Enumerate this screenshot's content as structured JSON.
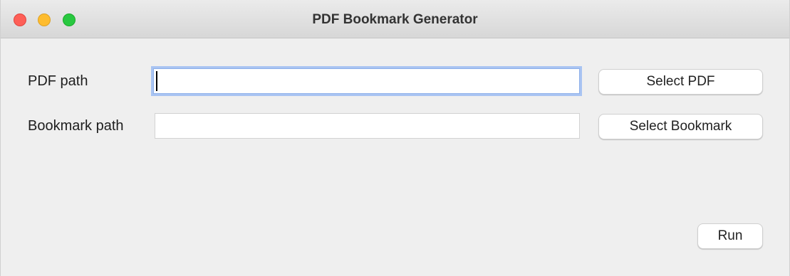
{
  "window": {
    "title": "PDF Bookmark Generator",
    "controls": [
      {
        "name": "close",
        "color": "#fe5f57"
      },
      {
        "name": "minimize",
        "color": "#febc2e"
      },
      {
        "name": "maximize",
        "color": "#28c840"
      }
    ]
  },
  "form": {
    "pdf_label": "PDF path",
    "pdf_value": "",
    "bookmark_label": "Bookmark path",
    "bookmark_value": ""
  },
  "buttons": {
    "select_pdf": "Select PDF",
    "select_bookmark": "Select Bookmark",
    "run": "Run"
  },
  "colors": {
    "focus_ring": "#a9c4f2",
    "background": "#efefef"
  }
}
